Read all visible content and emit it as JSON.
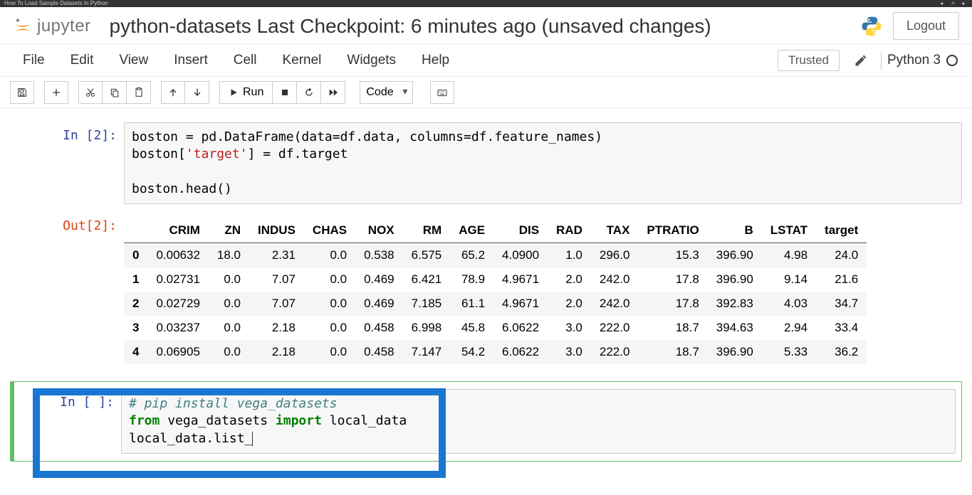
{
  "browser": {
    "tab_title": "How To Load Sample Datasets In Python"
  },
  "header": {
    "logo_text": "jupyter",
    "notebook_title": "python-datasets Last Checkpoint: 6 minutes ago  (unsaved changes)",
    "logout_label": "Logout"
  },
  "menubar": {
    "items": [
      "File",
      "Edit",
      "View",
      "Insert",
      "Cell",
      "Kernel",
      "Widgets",
      "Help"
    ],
    "trusted_label": "Trusted",
    "kernel_name": "Python 3"
  },
  "toolbar": {
    "run_label": "Run",
    "cell_type_value": "Code"
  },
  "cells": {
    "cell2_prompt": "In [2]:",
    "cell2_code_line1_pre": "boston = pd.DataFrame(data=df.data, columns=df.feature_names)",
    "cell2_code_line2_pre": "boston[",
    "cell2_code_line2_str": "'target'",
    "cell2_code_line2_post": "] = df.target",
    "cell2_code_line4": "boston.head()",
    "out2_prompt": "Out[2]:",
    "cell3_prompt": "In [ ]:",
    "cell3_line1": "# pip install vega_datasets",
    "cell3_line2_kw1": "from",
    "cell3_line2_mid": " vega_datasets ",
    "cell3_line2_kw2": "import",
    "cell3_line2_end": " local_data",
    "cell3_line3": "local_data.list_"
  },
  "chart_data": {
    "type": "table",
    "columns": [
      "",
      "CRIM",
      "ZN",
      "INDUS",
      "CHAS",
      "NOX",
      "RM",
      "AGE",
      "DIS",
      "RAD",
      "TAX",
      "PTRATIO",
      "B",
      "LSTAT",
      "target"
    ],
    "rows": [
      [
        "0",
        "0.00632",
        "18.0",
        "2.31",
        "0.0",
        "0.538",
        "6.575",
        "65.2",
        "4.0900",
        "1.0",
        "296.0",
        "15.3",
        "396.90",
        "4.98",
        "24.0"
      ],
      [
        "1",
        "0.02731",
        "0.0",
        "7.07",
        "0.0",
        "0.469",
        "6.421",
        "78.9",
        "4.9671",
        "2.0",
        "242.0",
        "17.8",
        "396.90",
        "9.14",
        "21.6"
      ],
      [
        "2",
        "0.02729",
        "0.0",
        "7.07",
        "0.0",
        "0.469",
        "7.185",
        "61.1",
        "4.9671",
        "2.0",
        "242.0",
        "17.8",
        "392.83",
        "4.03",
        "34.7"
      ],
      [
        "3",
        "0.03237",
        "0.0",
        "2.18",
        "0.0",
        "0.458",
        "6.998",
        "45.8",
        "6.0622",
        "3.0",
        "222.0",
        "18.7",
        "394.63",
        "2.94",
        "33.4"
      ],
      [
        "4",
        "0.06905",
        "0.0",
        "2.18",
        "0.0",
        "0.458",
        "7.147",
        "54.2",
        "6.0622",
        "3.0",
        "222.0",
        "18.7",
        "396.90",
        "5.33",
        "36.2"
      ]
    ]
  }
}
